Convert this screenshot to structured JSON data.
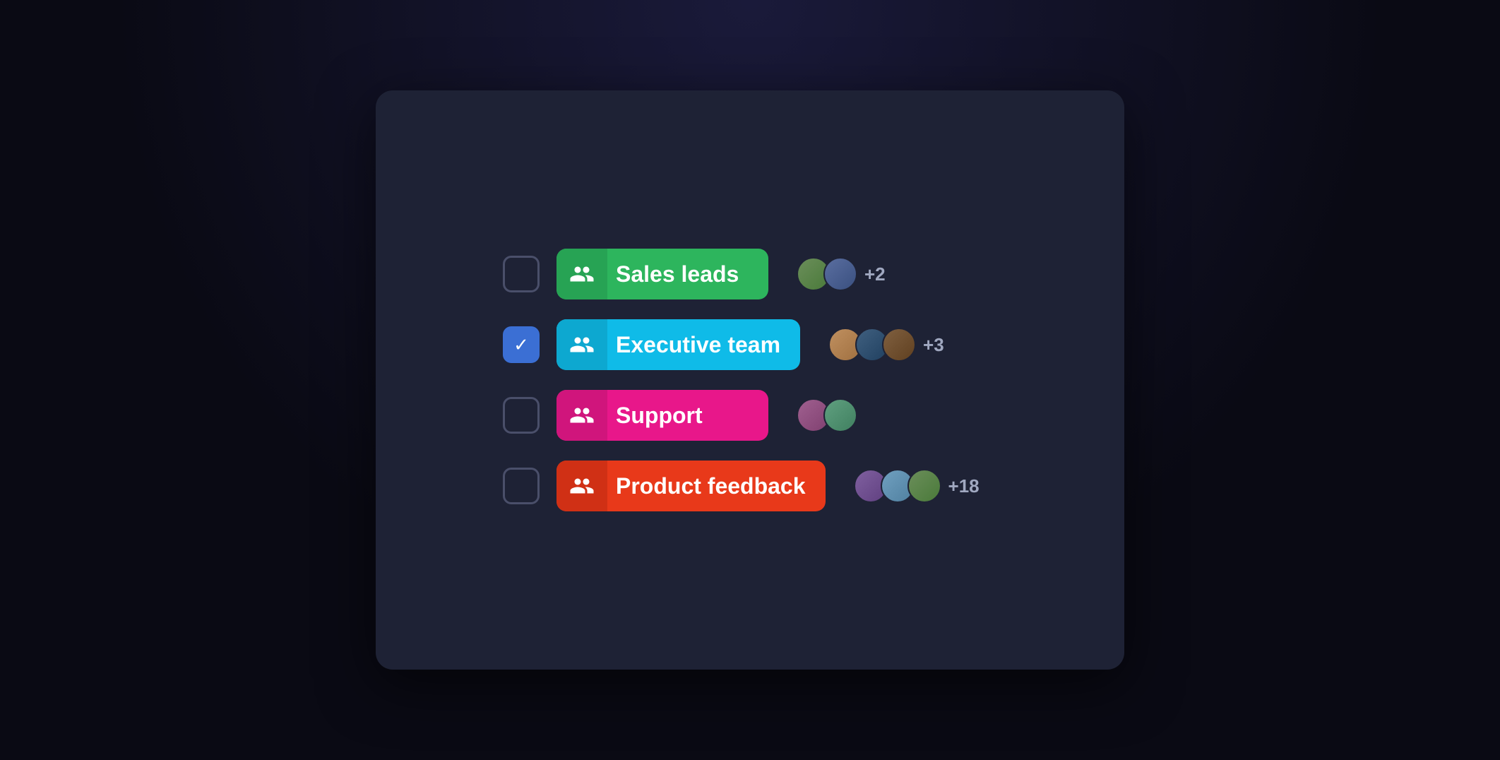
{
  "items": [
    {
      "id": "sales-leads",
      "label": "Sales leads",
      "checked": false,
      "colorClass": "tag-sales-leads",
      "avatars": [
        {
          "color": "av1",
          "initial": ""
        },
        {
          "color": "av2",
          "initial": ""
        }
      ],
      "extra_count": "+2"
    },
    {
      "id": "executive-team",
      "label": "Executive team",
      "checked": true,
      "colorClass": "tag-executive-team",
      "avatars": [
        {
          "color": "av3",
          "initial": ""
        },
        {
          "color": "av4",
          "initial": ""
        },
        {
          "color": "av5",
          "initial": ""
        }
      ],
      "extra_count": "+3"
    },
    {
      "id": "support",
      "label": "Support",
      "checked": false,
      "colorClass": "tag-support",
      "avatars": [
        {
          "color": "av6",
          "initial": ""
        },
        {
          "color": "av7",
          "initial": ""
        }
      ],
      "extra_count": ""
    },
    {
      "id": "product-feedback",
      "label": "Product feedback",
      "checked": false,
      "colorClass": "tag-product-feedback",
      "avatars": [
        {
          "color": "av8",
          "initial": ""
        },
        {
          "color": "av9",
          "initial": ""
        },
        {
          "color": "av1",
          "initial": ""
        }
      ],
      "extra_count": "+18"
    }
  ]
}
